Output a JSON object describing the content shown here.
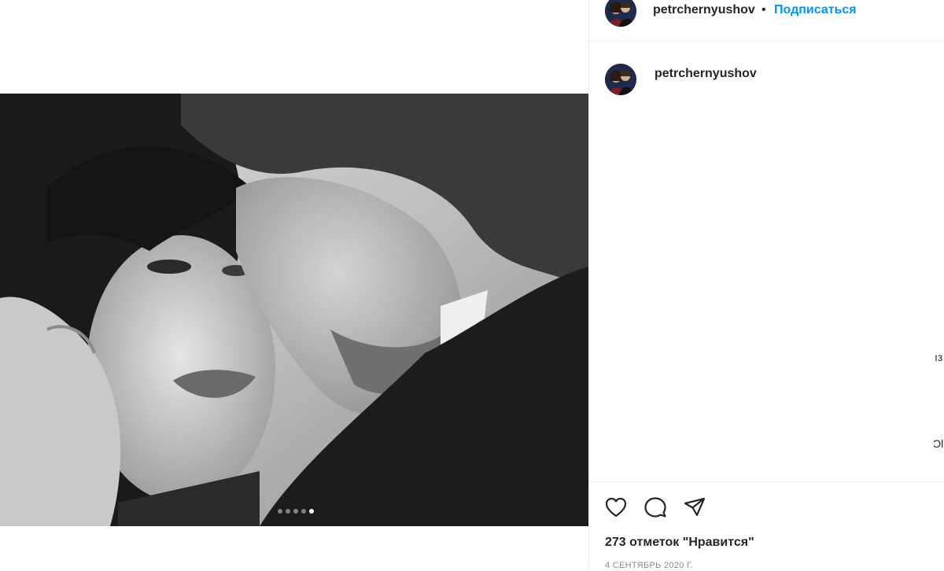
{
  "post": {
    "username": "petrchernyushov",
    "separator": "•",
    "follow_label": "Подписаться",
    "carousel": {
      "total": 5,
      "active_index": 4
    }
  },
  "comment": {
    "username": "petrchernyushov"
  },
  "edge": {
    "glyph_1": "ıз",
    "glyph_2": "Ͻl"
  },
  "actions": {
    "like_icon": "heart-icon",
    "comment_icon": "comment-icon",
    "share_icon": "send-icon"
  },
  "likes_text": "273 отметок \"Нравится\"",
  "date_text": "4 СЕНТЯБРЬ 2020 Г.",
  "colors": {
    "accent": "#0095f6",
    "text": "#262626",
    "muted": "#8e8e8e",
    "border": "#efefef"
  }
}
